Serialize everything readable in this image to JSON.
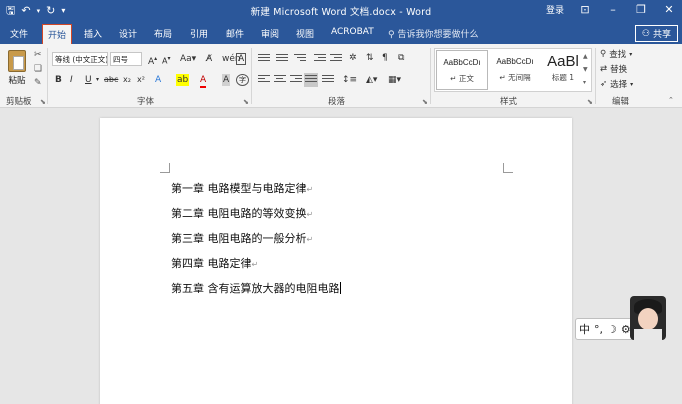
{
  "titlebar": {
    "title": "新建 Microsoft Word 文档.docx - Word",
    "login": "登录"
  },
  "tabs": [
    "文件",
    "开始",
    "插入",
    "设计",
    "布局",
    "引用",
    "邮件",
    "审阅",
    "视图",
    "ACROBAT"
  ],
  "active_tab": "开始",
  "tell_me": "告诉我你想要做什么",
  "share_label": "共享",
  "ribbon": {
    "paste_label": "粘贴",
    "font_name": "等线 (中文正文)",
    "font_size": "四号",
    "groups": {
      "clipboard": "剪贴板",
      "font": "字体",
      "paragraph": "段落",
      "styles": "样式",
      "editing": "编辑"
    },
    "styles": [
      {
        "sample": "AaBbCcDı",
        "name": "↵ 正文"
      },
      {
        "sample": "AaBbCcDı",
        "name": "↵ 无间隔"
      },
      {
        "sample": "AaBl",
        "name": "标题 1"
      }
    ],
    "editing": {
      "find": "查找",
      "replace": "替换",
      "select": "选择"
    }
  },
  "document": {
    "lines": [
      "第一章  电路模型与电路定律",
      "第二章  电阻电路的等效变换",
      "第三章  电阻电路的一般分析",
      "第四章  电路定律",
      "第五章  含有运算放大器的电阻电路"
    ],
    "para_mark": "↵"
  },
  "ime": {
    "mode": "中"
  },
  "colors": {
    "title_bar": "#2b579a",
    "ribbon_bg": "#f3f3f3",
    "active_tab_border": "#d24726"
  }
}
